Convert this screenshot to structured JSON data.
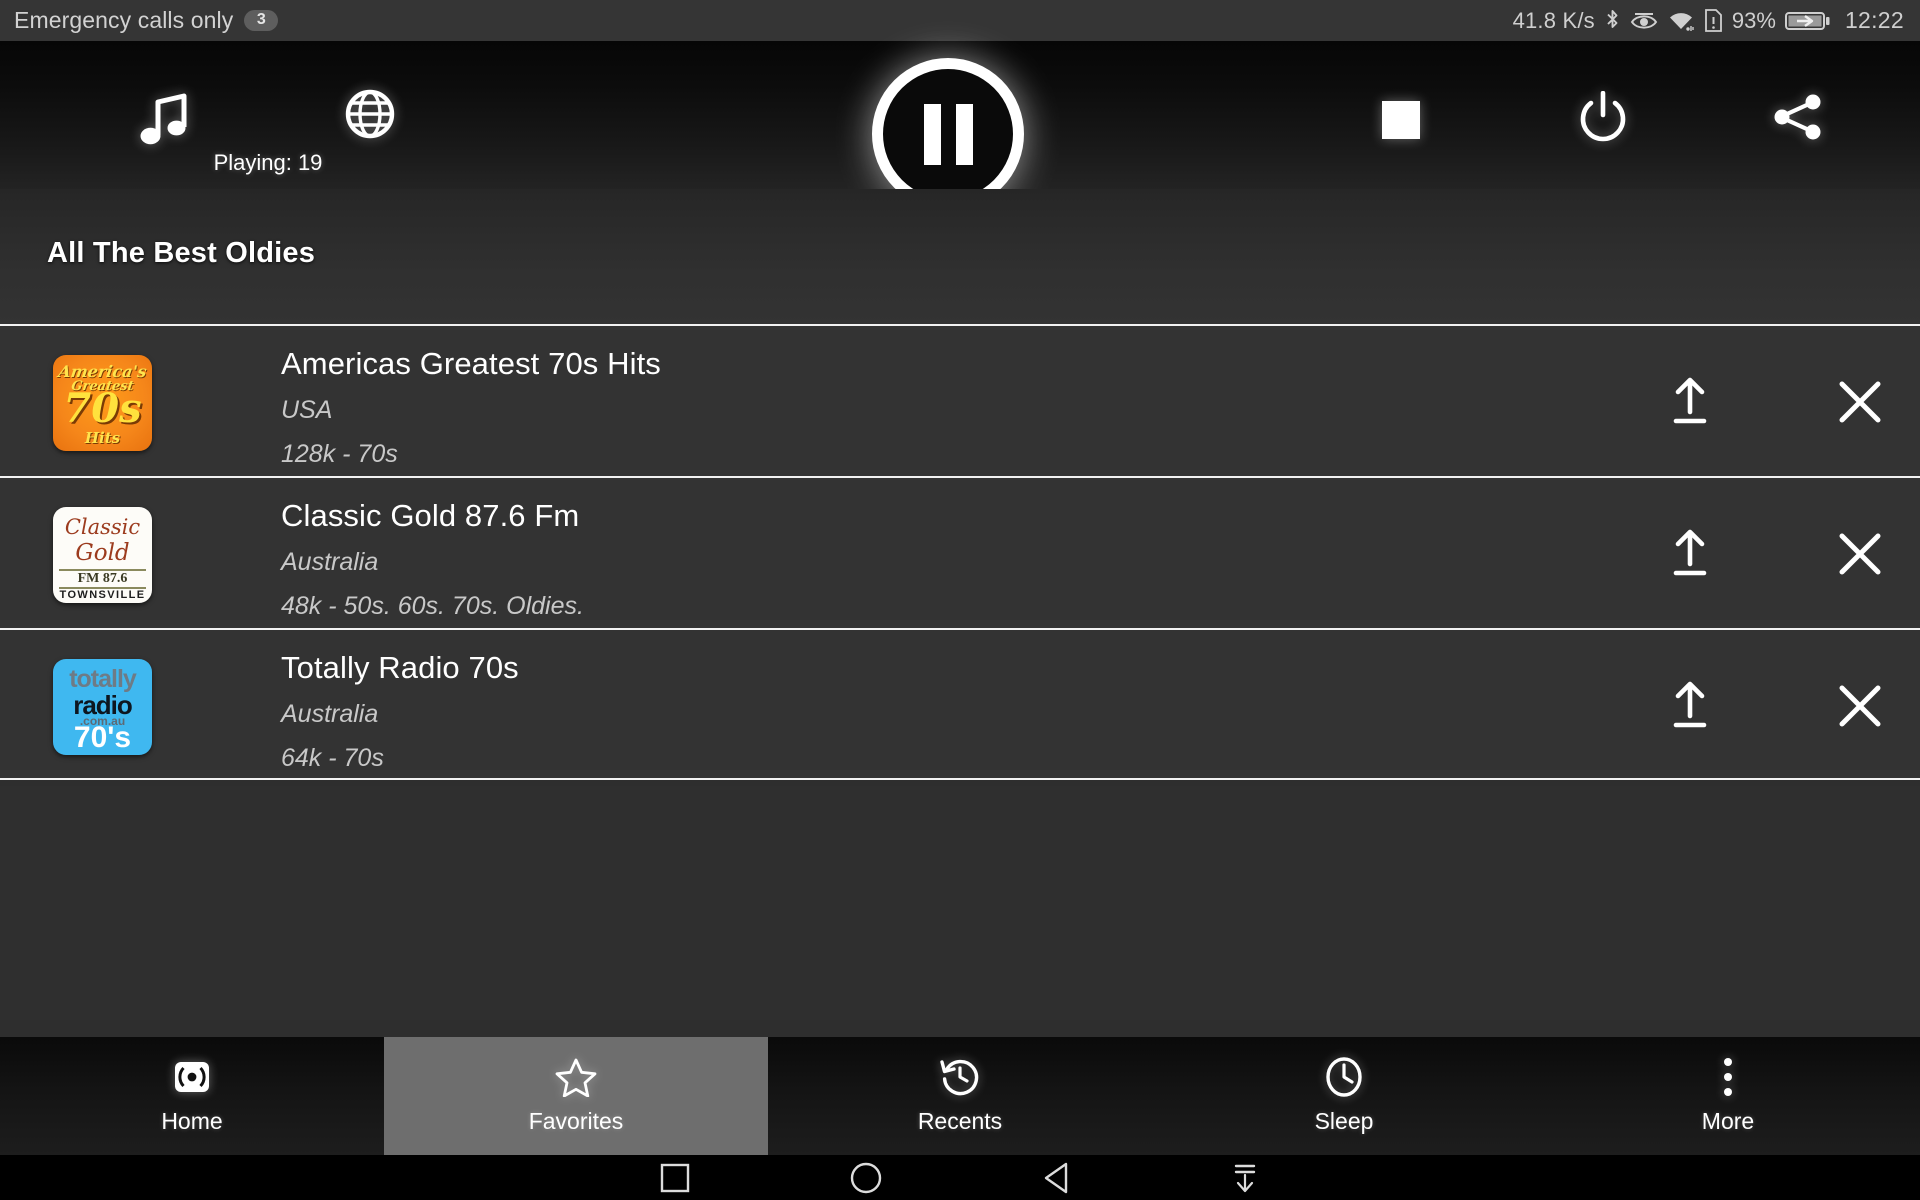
{
  "status_bar": {
    "carrier": "Emergency calls only",
    "notification_count": "3",
    "network_speed": "41.8 K/s",
    "battery_percent": "93%",
    "clock": "12:22",
    "icons": [
      "bluetooth-icon",
      "eye-icon",
      "wifi-icon",
      "sim-alert-icon",
      "battery-charging-icon"
    ]
  },
  "player": {
    "music_icon": "music-note-icon",
    "globe_icon": "globe-icon",
    "playing_label": "Playing: 19",
    "pause_icon": "pause-icon",
    "stop_icon": "stop-icon",
    "power_icon": "power-icon",
    "share_icon": "share-icon"
  },
  "section": {
    "title": "All The Best Oldies"
  },
  "stations": [
    {
      "name": "Americas Greatest 70s Hits",
      "country": "USA",
      "meta": "128k - 70s",
      "logo": {
        "kind": "americas-greatest-70s",
        "line1": "America's",
        "line2": "Greatest",
        "line3": "70s",
        "line4": "Hits"
      },
      "move_action": "move-to-top",
      "delete_action": "remove"
    },
    {
      "name": "Classic Gold 87.6 Fm",
      "country": "Australia",
      "meta": "48k - 50s. 60s. 70s. Oldies.",
      "logo": {
        "kind": "classic-gold",
        "line1": "Classic",
        "line2": "Gold",
        "line3": "FM 87.6",
        "line4": "TOWNSVILLE"
      },
      "move_action": "move-to-top",
      "delete_action": "remove"
    },
    {
      "name": "Totally Radio 70s",
      "country": "Australia",
      "meta": "64k - 70s",
      "logo": {
        "kind": "totally-radio-70s",
        "line1": "totally",
        "line2": "radio",
        "line3": ".com.au",
        "line4": "70's"
      },
      "move_action": "move-to-top",
      "delete_action": "remove"
    }
  ],
  "bottom_nav": {
    "active": "Favorites",
    "items": [
      {
        "label": "Home",
        "icon": "broadcast-icon"
      },
      {
        "label": "Favorites",
        "icon": "star-icon"
      },
      {
        "label": "Recents",
        "icon": "history-icon"
      },
      {
        "label": "Sleep",
        "icon": "clock-icon"
      },
      {
        "label": "More",
        "icon": "overflow-dots-icon"
      }
    ]
  },
  "system_nav": {
    "items": [
      "recents-square-icon",
      "home-circle-icon",
      "back-triangle-icon",
      "hide-keyboard-icon"
    ]
  },
  "colors": {
    "background": "#333333",
    "toolbar": "#0c0c0c",
    "accent_highlight": "#6e6e6e",
    "divider": "#f2f2f2",
    "text_primary": "#ffffff",
    "text_secondary": "#c8c8c8"
  }
}
